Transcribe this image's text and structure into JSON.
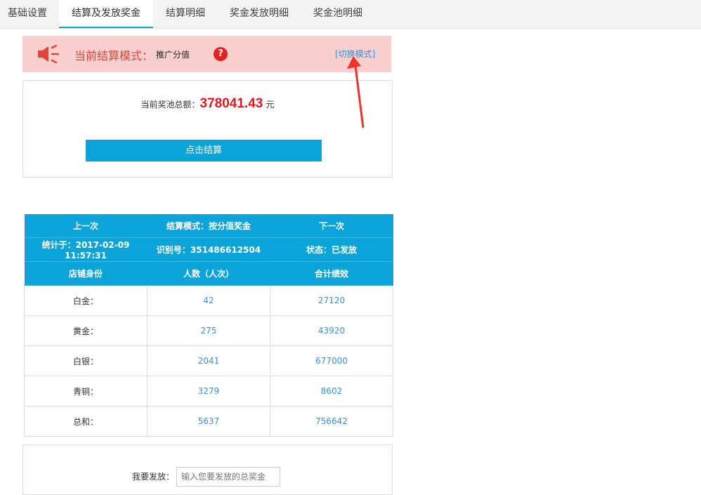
{
  "tabs": [
    "基础设置",
    "结算及发放奖金",
    "结算明细",
    "奖金发放明细",
    "奖金池明细"
  ],
  "mode_bar": {
    "label": "当前结算模式：",
    "value": "推广分值",
    "help": "?",
    "switch_link": "[切换模式]"
  },
  "pool": {
    "label": "当前奖池总额：",
    "amount": "378041.43",
    "unit": "元",
    "button": "点击结算"
  },
  "summary": {
    "row1": [
      "上一次",
      "结算模式：按分值奖金",
      "下一次"
    ],
    "row2": [
      "统计于：2017-02-09 11:57:31",
      "识别号：351486612504",
      "状态：已发放"
    ],
    "headers": [
      "店铺身份",
      "人数（人次）",
      "合计绩效"
    ],
    "rows": [
      [
        "白金：",
        "42",
        "27120"
      ],
      [
        "黄金：",
        "275",
        "43920"
      ],
      [
        "白银：",
        "2041",
        "677000"
      ],
      [
        "青铜：",
        "3279",
        "8602"
      ],
      [
        "总和：",
        "5637",
        "756642"
      ]
    ]
  },
  "issue": {
    "label": "我要发放：",
    "placeholder": "输入您要发放的总奖金"
  },
  "colors": {
    "accent": "#0aa4d8",
    "alert_bg": "#f8cfcc",
    "amount": "#e4171e",
    "link": "#3b8fd6"
  },
  "icons": [
    "speaker-icon",
    "help-icon",
    "annotation-arrow"
  ]
}
